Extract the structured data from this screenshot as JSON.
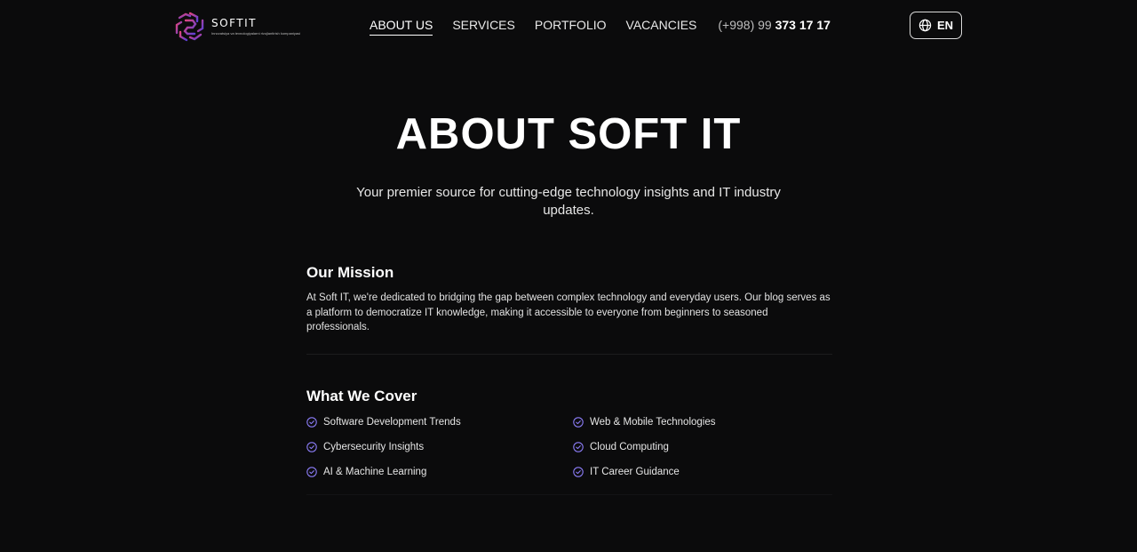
{
  "header": {
    "logo": {
      "name": "SOFTIT",
      "tagline": "Innovatsiya va texnologiyalarni rivojlantirish kompaniyasi"
    },
    "nav": [
      {
        "label": "ABOUT US",
        "active": true
      },
      {
        "label": "SERVICES",
        "active": false
      },
      {
        "label": "PORTFOLIO",
        "active": false
      },
      {
        "label": "VACANCIES",
        "active": false
      }
    ],
    "phone": {
      "prefix": "(+998) 99",
      "number": "373 17 17"
    },
    "language": {
      "label": "EN",
      "icon": "globe-icon"
    }
  },
  "hero": {
    "title": "ABOUT SOFT IT",
    "subtitle": "Your premier source for cutting-edge technology insights and IT industry updates."
  },
  "mission": {
    "title": "Our Mission",
    "text": "At Soft IT, we're dedicated to bridging the gap between complex technology and everyday users. Our blog serves as a platform to democratize IT knowledge, making it accessible to everyone from beginners to seasoned professionals."
  },
  "cover": {
    "title": "What We Cover",
    "items": [
      "Software Development Trends",
      "Web & Mobile Technologies",
      "Cybersecurity Insights",
      "Cloud Computing",
      "AI & Machine Learning",
      "IT Career Guidance"
    ],
    "icon": "check-circle-icon"
  },
  "colors": {
    "background": "#0b0b0c",
    "accent": "#8b7cf6",
    "logo_pink": "#d63b8c",
    "logo_purple": "#6a3fd0"
  }
}
